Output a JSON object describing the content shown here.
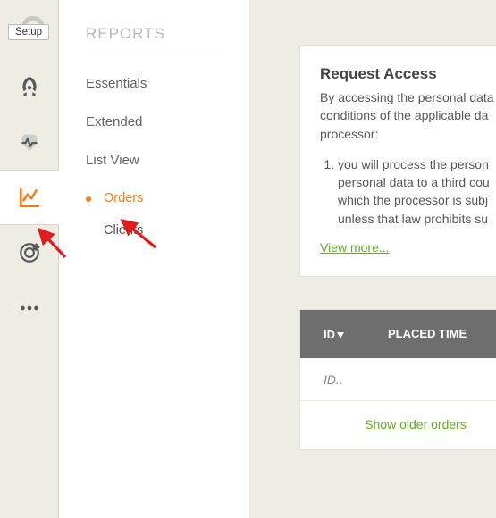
{
  "setupBadge": "Setup",
  "submenu": {
    "title": "REPORTS",
    "items": [
      "Essentials",
      "Extended",
      "List View"
    ],
    "subitems": [
      "Orders",
      "Clients"
    ],
    "activeSub": "Orders"
  },
  "iconbar": [
    "gauge",
    "rocket",
    "heartbeat",
    "chart",
    "target",
    "more"
  ],
  "activeIcon": "chart",
  "request": {
    "title": "Request Access",
    "intro": "By accessing the personal data conditions of the applicable da processor:",
    "point1": "you will process the person personal data to a third cou which the processor is subj unless that law prohibits su",
    "viewMore": "View more..."
  },
  "table": {
    "col_id": "ID",
    "col_time": "PLACED TIME",
    "row1_id": "ID..",
    "footer": "Show older orders"
  }
}
